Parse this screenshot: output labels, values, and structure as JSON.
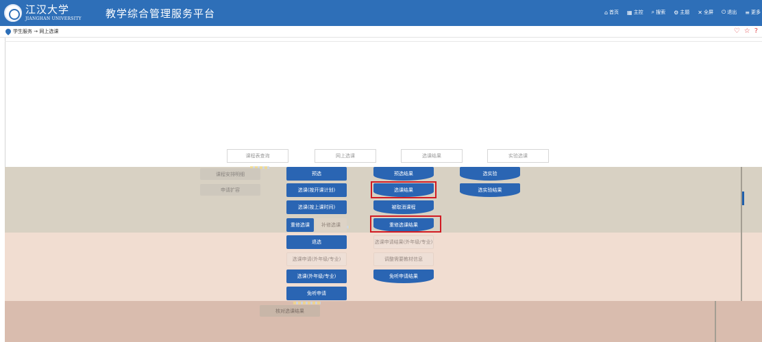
{
  "header": {
    "logo_cn": "江汉大学",
    "logo_en": "JIANGHAN UNIVERSITY",
    "title": "教学综合管理服务平台",
    "nav": [
      {
        "icon": "home-icon",
        "glyph": "⌂",
        "label": "首页"
      },
      {
        "icon": "dashboard-icon",
        "glyph": "▦",
        "label": "主控"
      },
      {
        "icon": "search-icon",
        "glyph": "⌕",
        "label": "搜索"
      },
      {
        "icon": "theme-icon",
        "glyph": "⚙",
        "label": "主题"
      },
      {
        "icon": "fullscreen-icon",
        "glyph": "✕",
        "label": "全屏"
      },
      {
        "icon": "logout-icon",
        "glyph": "⏻",
        "label": "退出"
      },
      {
        "icon": "more-icon",
        "glyph": "≡",
        "label": "更多"
      }
    ]
  },
  "breadcrumb": {
    "text": "学生服务 → 网上选课"
  },
  "tabs": [
    "课程表查询",
    "网上选课",
    "选课结果",
    "实验选课"
  ],
  "left_buttons": [
    "课程安排明细",
    "申请扩容"
  ],
  "col1": [
    "预选",
    "选课(按开课计划)",
    "选课(按上课时间)",
    "重修选课",
    "补修选课",
    "退选",
    "选课申请(外年级/专业)",
    "选课(外年级/专业)",
    "免听申请"
  ],
  "col2": [
    "预选结果",
    "选课结果",
    "被取消课程",
    "重修选课结果",
    "选课申请结果(外年级/专业)",
    "调整需要教材信息",
    "免听申请结果"
  ],
  "col3": [
    "选实验",
    "选实验结果"
  ],
  "bottom_button": "核对选课结果",
  "colors": {
    "brand": "#2e6fb8",
    "button": "#2a65b3",
    "highlight": "#d11a22"
  }
}
